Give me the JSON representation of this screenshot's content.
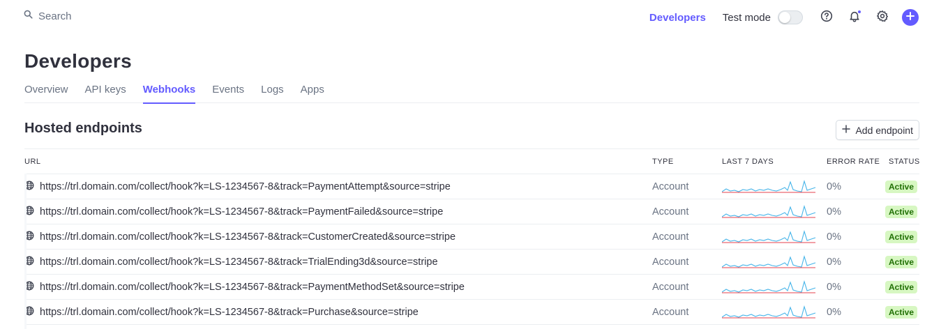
{
  "search": {
    "placeholder": "Search"
  },
  "topnav": {
    "developers_label": "Developers",
    "test_mode_label": "Test mode",
    "test_mode_on": false
  },
  "page": {
    "title": "Developers",
    "tabs": [
      {
        "label": "Overview",
        "active": false
      },
      {
        "label": "API keys",
        "active": false
      },
      {
        "label": "Webhooks",
        "active": true
      },
      {
        "label": "Events",
        "active": false
      },
      {
        "label": "Logs",
        "active": false
      },
      {
        "label": "Apps",
        "active": false
      }
    ]
  },
  "section": {
    "title": "Hosted endpoints",
    "add_button_label": "Add endpoint"
  },
  "table": {
    "columns": {
      "url": "URL",
      "type": "TYPE",
      "last7": "LAST 7 DAYS",
      "error_rate": "ERROR RATE",
      "status": "STATUS"
    },
    "rows": [
      {
        "url": "https://trl.domain.com/collect/hook?k=LS-1234567-8&track=PaymentAttempt&source=stripe",
        "type": "Account",
        "error_rate": "0%",
        "status": "Active"
      },
      {
        "url": "https://trl.domain.com/collect/hook?k=LS-1234567-8&track=PaymentFailed&source=stripe",
        "type": "Account",
        "error_rate": "0%",
        "status": "Active"
      },
      {
        "url": "https://trl.domain.com/collect/hook?k=LS-1234567-8&track=CustomerCreated&source=stripe",
        "type": "Account",
        "error_rate": "0%",
        "status": "Active"
      },
      {
        "url": "https://trl.domain.com/collect/hook?k=LS-1234567-8&track=TrialEnding3d&source=stripe",
        "type": "Account",
        "error_rate": "0%",
        "status": "Active"
      },
      {
        "url": "https://trl.domain.com/collect/hook?k=LS-1234567-8&track=PaymentMethodSet&source=stripe",
        "type": "Account",
        "error_rate": "0%",
        "status": "Active"
      },
      {
        "url": "https://trl.domain.com/collect/hook?k=LS-1234567-8&track=Purchase&source=stripe",
        "type": "Account",
        "error_rate": "0%",
        "status": "Active"
      }
    ]
  },
  "colors": {
    "accent": "#635bff",
    "sparkline_success": "#45b4e9",
    "sparkline_error": "#e5424d",
    "badge_bg": "#d7f7c2",
    "badge_text": "#217005"
  },
  "icons": {
    "search": "search-icon",
    "help": "help-icon",
    "notifications": "bell-icon",
    "settings": "gear-icon",
    "create": "plus-icon",
    "endpoint": "globe-icon"
  }
}
